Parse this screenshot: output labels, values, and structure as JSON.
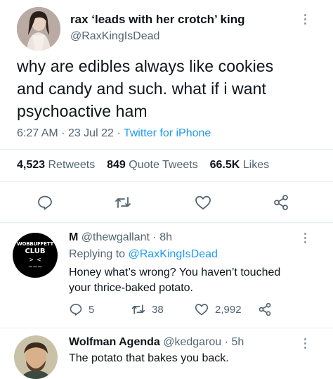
{
  "main_tweet": {
    "display_name": "rax ‘leads with her crotch’ king",
    "handle": "@RaxKingIsDead",
    "text_lines": [
      "why are edibles always like cookies",
      "and candy and such. what if i want",
      "psychoactive ham"
    ],
    "time": "6:27 AM",
    "separator1": "·",
    "date": "23 Jul 22",
    "separator2": "·",
    "source": "Twitter for iPhone",
    "stats": {
      "retweets_count": "4,523",
      "retweets_label": "Retweets",
      "quotes_count": "849",
      "quotes_label": "Quote Tweets",
      "likes_count": "66.5K",
      "likes_label": "Likes"
    }
  },
  "reply_1": {
    "display_name": "M",
    "handle": "@thewgallant",
    "separator": "·",
    "age": "8h",
    "replying_prefix": "Replying to",
    "replying_handle": "@RaxKingIsDead",
    "text_lines": [
      "Honey what’s wrong? You haven’t touched",
      "your thrice-baked potato."
    ],
    "avatar_text": [
      "WOBBUFFETT",
      "CLUB",
      ">  <",
      "∼∼∼"
    ],
    "replies": "5",
    "retweets": "38",
    "likes": "2,992"
  },
  "reply_2": {
    "display_name": "Wolfman Agenda",
    "handle": "@kedgarou",
    "separator": "·",
    "age": "5h",
    "text": "The potato that bakes you back."
  },
  "colors": {
    "text": "#0f1419",
    "muted": "#536471",
    "accent": "#1d9bf0",
    "divider": "#e6ecf0"
  },
  "icons": {
    "reply": "speech-bubble-icon",
    "retweet": "retweet-arrows-icon",
    "like": "heart-icon",
    "share": "share-nodes-icon",
    "more": "vertical-dots-icon"
  }
}
